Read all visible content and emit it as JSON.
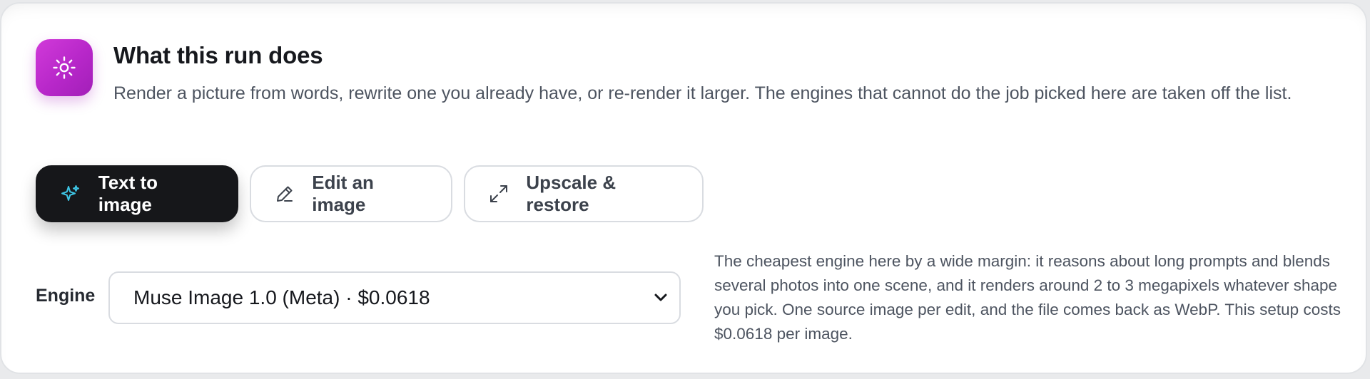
{
  "header": {
    "icon": "sun-sparkle-icon",
    "title": "What this run does",
    "description": "Render a picture from words, rewrite one you already have, or re-render it larger. The engines that cannot do the job picked here are taken off the list."
  },
  "modes": [
    {
      "label": "Text to image",
      "icon": "sparkles-icon",
      "selected": true
    },
    {
      "label": "Edit an image",
      "icon": "pencil-icon",
      "selected": false
    },
    {
      "label": "Upscale & restore",
      "icon": "expand-arrows-icon",
      "selected": false
    }
  ],
  "engine": {
    "label": "Engine",
    "selected": "Muse Image 1.0 (Meta) · $0.0618",
    "note": "The cheapest engine here by a wide margin: it reasons about long prompts and blends several photos into one scene, and it renders around 2 to 3 megapixels whatever shape you pick. One source image per edit, and the file comes back as WebP. This setup costs $0.0618 per image."
  },
  "colors": {
    "accent_gradient_start": "#d13ad9",
    "accent_gradient_end": "#a21fb8",
    "active_button_bg": "#16171a",
    "sparkle_icon": "#3ec6e6"
  }
}
